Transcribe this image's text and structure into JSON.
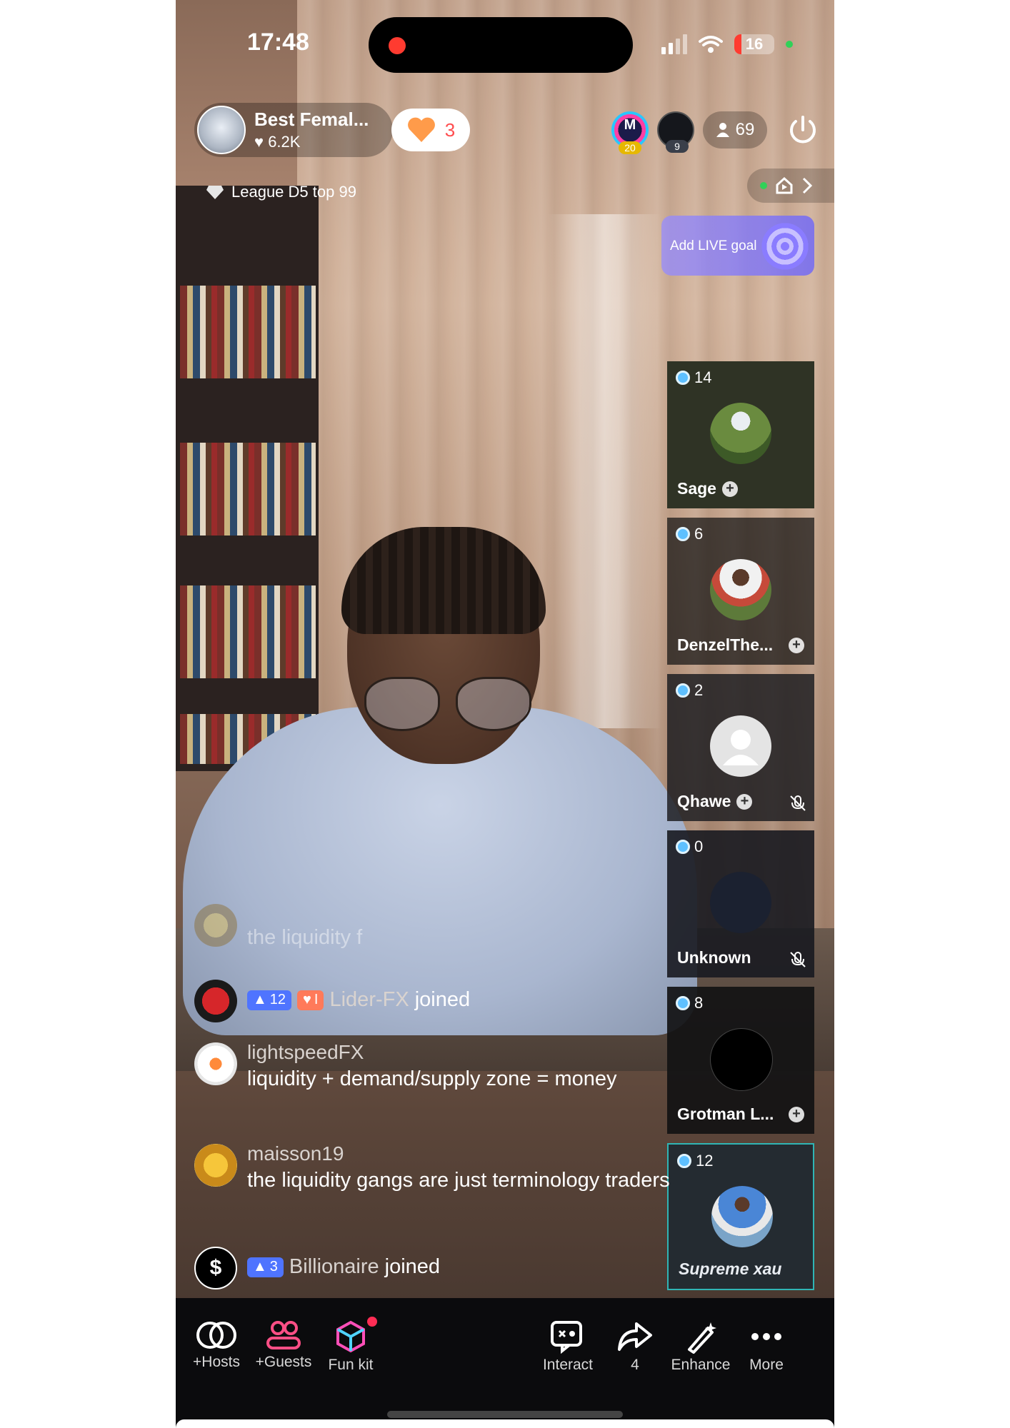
{
  "status_bar": {
    "time": "17:48",
    "battery": "16"
  },
  "host": {
    "name": "Best Femal...",
    "likes": "6.2K",
    "hearts": "3",
    "league": "League D5 top 99"
  },
  "top_viewers": [
    {
      "label": "M",
      "level": "20"
    },
    {
      "label": "",
      "level": "9"
    }
  ],
  "viewer_count": "69",
  "live_goal": {
    "label": "Add LIVE goal"
  },
  "guests": [
    {
      "count": "14",
      "name": "Sage",
      "avatar": "person-outdoor",
      "muted": false,
      "add": true
    },
    {
      "count": "6",
      "name": "DenzelThe...",
      "avatar": "person-outdoor",
      "muted": false,
      "add": true
    },
    {
      "count": "2",
      "name": "Qhawe",
      "avatar": "default-avatar",
      "muted": true,
      "add": true
    },
    {
      "count": "0",
      "name": "Unknown",
      "avatar": "dark-avatar",
      "muted": true,
      "add": false
    },
    {
      "count": "8",
      "name": "Grotman L...",
      "avatar": "logo-avatar",
      "muted": false,
      "add": true
    },
    {
      "count": "12",
      "name": "Supreme xau",
      "avatar": "person-outdoor",
      "muted": false,
      "add": false
    }
  ],
  "chat": {
    "faded": {
      "username": "",
      "text": "the liquidity f"
    },
    "join1": {
      "level": "12",
      "fan_level": "I",
      "username": "Lider-FX",
      "suffix": "joined"
    },
    "msg1": {
      "username": "lightspeedFX",
      "text": "liquidity + demand/supply zone = money"
    },
    "msg2": {
      "username": "maisson19",
      "text": "the liquidity gangs are just terminology traders"
    },
    "join2": {
      "level": "3",
      "username": "Billionaire",
      "suffix": "joined"
    }
  },
  "toolbar": {
    "hosts": "+Hosts",
    "guests": "+Guests",
    "funkit": "Fun kit",
    "interact": "Interact",
    "share_count": "4",
    "enhance": "Enhance",
    "more": "More"
  },
  "colors": {
    "accent_pink": "#ff2d55",
    "level_blue": "#4f74ff",
    "goal_purple": "#8a7cff"
  }
}
